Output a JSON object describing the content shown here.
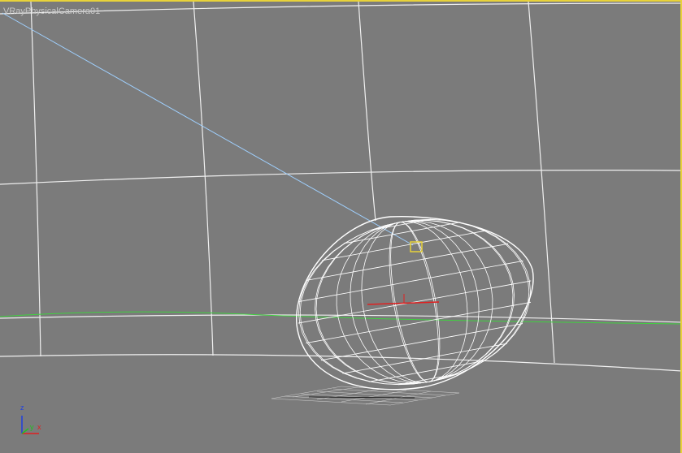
{
  "viewport": {
    "label": "VRayPhysicalCamera01",
    "mode": "wireframe"
  },
  "colors": {
    "background": "#7b7b7b",
    "active_border": "#e8d23a",
    "wireframe": "#ffffff",
    "camera_line": "#9fd0ff",
    "horizon": "#40d040",
    "gizmo_x": "#e02020",
    "gizmo_y": "#20c020",
    "gizmo_z": "#2040e0"
  },
  "axis_tripod": {
    "x_label": "x",
    "y_label": "y",
    "z_label": "z"
  }
}
